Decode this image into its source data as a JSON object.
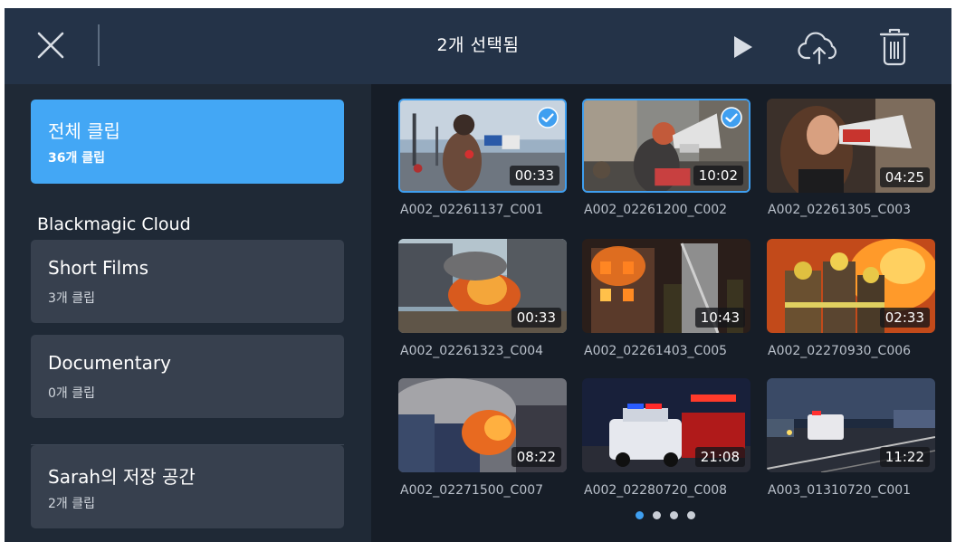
{
  "header": {
    "title": "2개 선택됨"
  },
  "sidebar": {
    "all_clips": {
      "name": "전체 클립",
      "count": "36개 클립"
    },
    "cloud_label": "Blackmagic Cloud",
    "projects": [
      {
        "name": "Short Films",
        "count": "3개 클립"
      },
      {
        "name": "Documentary",
        "count": "0개 클립"
      }
    ],
    "storage": {
      "name": "Sarah의 저장 공간",
      "count": "2개 클립"
    }
  },
  "clips": [
    {
      "name": "A002_02261137_C001",
      "duration": "00:33",
      "selected": true
    },
    {
      "name": "A002_02261200_C002",
      "duration": "10:02",
      "selected": true
    },
    {
      "name": "A002_02261305_C003",
      "duration": "04:25",
      "selected": false
    },
    {
      "name": "A002_02261323_C004",
      "duration": "00:33",
      "selected": false
    },
    {
      "name": "A002_02261403_C005",
      "duration": "10:43",
      "selected": false
    },
    {
      "name": "A002_02270930_C006",
      "duration": "02:33",
      "selected": false
    },
    {
      "name": "A002_02271500_C007",
      "duration": "08:22",
      "selected": false
    },
    {
      "name": "A002_02280720_C008",
      "duration": "21:08",
      "selected": false
    },
    {
      "name": "A003_01310720_C001",
      "duration": "11:22",
      "selected": false
    }
  ],
  "pagination": {
    "total": 4,
    "current": 1
  },
  "colors": {
    "accent": "#3f9ff0",
    "active_card": "#43a7f5",
    "header": "#243348",
    "sidebar": "#1f2936",
    "background": "#161d27"
  }
}
